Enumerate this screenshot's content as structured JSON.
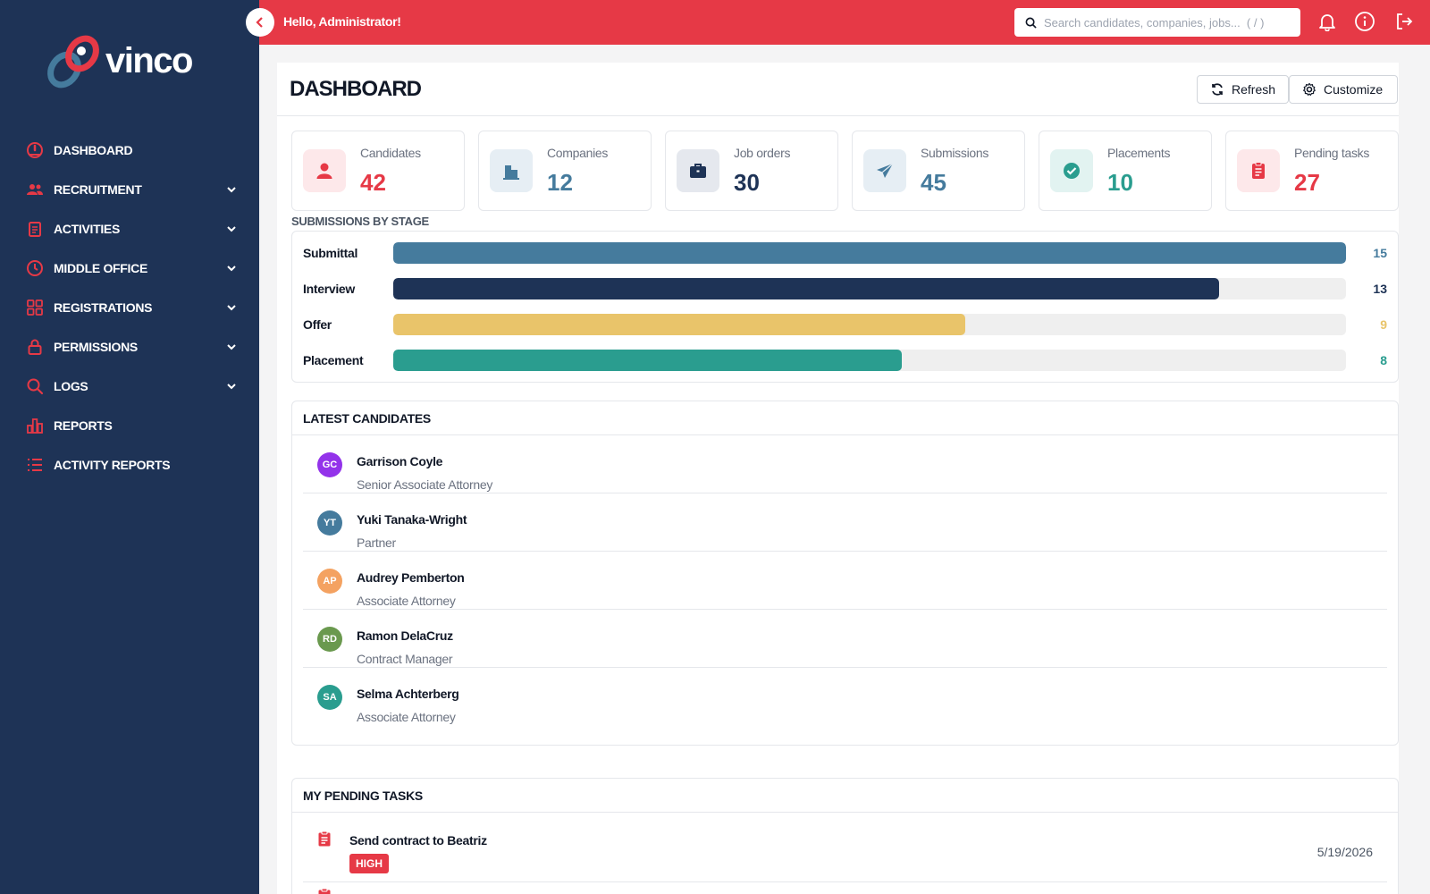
{
  "app": {
    "brand": "vinco",
    "greeting": "Hello, Administrator!"
  },
  "search": {
    "placeholder": "Search candidates, companies, jobs...  ( / )"
  },
  "sidebar": {
    "items": [
      {
        "label": "DASHBOARD",
        "icon": "gauge-icon",
        "expandable": false
      },
      {
        "label": "RECRUITMENT",
        "icon": "users-icon",
        "expandable": true
      },
      {
        "label": "ACTIVITIES",
        "icon": "clipboard-icon",
        "expandable": true
      },
      {
        "label": "MIDDLE OFFICE",
        "icon": "clock-icon",
        "expandable": true
      },
      {
        "label": "REGISTRATIONS",
        "icon": "grid-icon",
        "expandable": true
      },
      {
        "label": "PERMISSIONS",
        "icon": "lock-icon",
        "expandable": true
      },
      {
        "label": "LOGS",
        "icon": "search-icon",
        "expandable": true
      },
      {
        "label": "REPORTS",
        "icon": "bar-chart-icon",
        "expandable": false
      },
      {
        "label": "ACTIVITY REPORTS",
        "icon": "list-icon",
        "expandable": false
      }
    ]
  },
  "page": {
    "title": "DASHBOARD",
    "refresh_label": "Refresh",
    "customize_label": "Customize"
  },
  "stats": [
    {
      "label": "Candidates",
      "value": "42",
      "color": "#e63946",
      "bg": "#fde8ea",
      "icon": "user-icon"
    },
    {
      "label": "Companies",
      "value": "12",
      "color": "#457b9d",
      "bg": "#e6eef4",
      "icon": "building-icon"
    },
    {
      "label": "Job orders",
      "value": "30",
      "color": "#1e3356",
      "bg": "#e5e8ee",
      "icon": "briefcase-icon"
    },
    {
      "label": "Submissions",
      "value": "45",
      "color": "#457b9d",
      "bg": "#e6eef4",
      "icon": "paper-plane-icon"
    },
    {
      "label": "Placements",
      "value": "10",
      "color": "#2a9d8f",
      "bg": "#e2f3f1",
      "icon": "check-circle-icon"
    },
    {
      "label": "Pending tasks",
      "value": "27",
      "color": "#e63946",
      "bg": "#fde8ea",
      "icon": "task-clipboard-icon"
    }
  ],
  "stages": {
    "title": "SUBMISSIONS BY STAGE",
    "max": 15,
    "items": [
      {
        "name": "Submittal",
        "value": 15,
        "color": "#457b9d"
      },
      {
        "name": "Interview",
        "value": 13,
        "color": "#1e3356"
      },
      {
        "name": "Offer",
        "value": 9,
        "color": "#e9c46a"
      },
      {
        "name": "Placement",
        "value": 8,
        "color": "#2a9d8f"
      }
    ]
  },
  "candidates": {
    "title": "LATEST CANDIDATES",
    "items": [
      {
        "initials": "GC",
        "name": "Garrison Coyle",
        "role": "Senior Associate Attorney",
        "color": "#9333ea"
      },
      {
        "initials": "YT",
        "name": "Yuki Tanaka-Wright",
        "role": "Partner",
        "color": "#457b9d"
      },
      {
        "initials": "AP",
        "name": "Audrey Pemberton",
        "role": "Associate Attorney",
        "color": "#f4a261"
      },
      {
        "initials": "RD",
        "name": "Ramon DelaCruz",
        "role": "Contract Manager",
        "color": "#6a994e"
      },
      {
        "initials": "SA",
        "name": "Selma Achterberg",
        "role": "Associate Attorney",
        "color": "#2a9d8f"
      }
    ]
  },
  "tasks": {
    "title": "MY PENDING TASKS",
    "items": [
      {
        "name": "Send contract to Beatriz",
        "priority": "HIGH",
        "date": "5/19/2026"
      }
    ]
  }
}
